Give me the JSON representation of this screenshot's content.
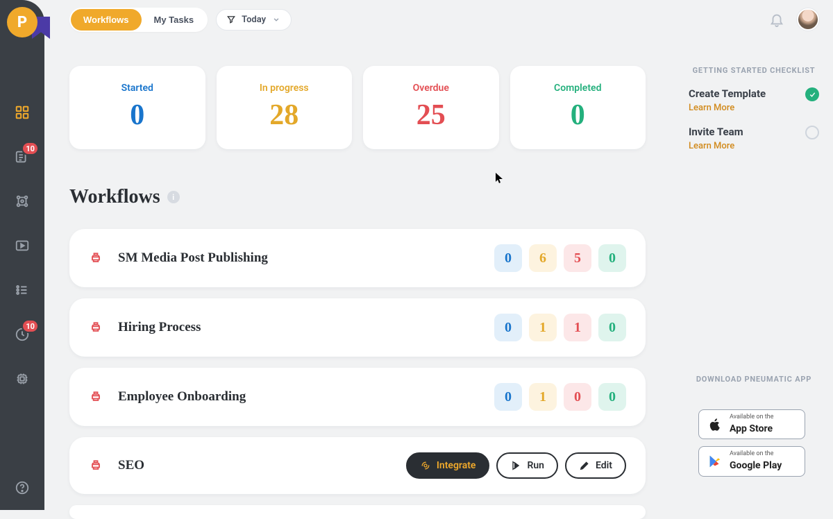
{
  "topbar": {
    "tabs": {
      "workflows": "Workflows",
      "mytasks": "My Tasks"
    },
    "dateFilter": "Today"
  },
  "stats": {
    "started": {
      "label": "Started",
      "value": "0"
    },
    "progress": {
      "label": "In progress",
      "value": "28"
    },
    "overdue": {
      "label": "Overdue",
      "value": "25"
    },
    "completed": {
      "label": "Completed",
      "value": "0"
    }
  },
  "section": {
    "title": "Workflows"
  },
  "sidebar": {
    "badge1": "10",
    "badge2": "10"
  },
  "workflows": [
    {
      "name": "SM Media Post Publishing",
      "s": "0",
      "p": "6",
      "o": "5",
      "c": "0"
    },
    {
      "name": "Hiring Process",
      "s": "0",
      "p": "1",
      "o": "1",
      "c": "0"
    },
    {
      "name": "Employee Onboarding",
      "s": "0",
      "p": "1",
      "o": "0",
      "c": "0"
    },
    {
      "name": "SEO"
    }
  ],
  "rowActions": {
    "integrate": "Integrate",
    "run": "Run",
    "edit": "Edit"
  },
  "checklist": {
    "title": "GETTING STARTED CHECKLIST",
    "learn": "Learn More",
    "items": [
      {
        "title": "Create Template",
        "done": true
      },
      {
        "title": "Invite Team",
        "done": false
      }
    ]
  },
  "download": {
    "title": "DOWNLOAD PNEUMATIC APP",
    "appstore_small": "Available on the",
    "appstore_big": "App Store",
    "play_small": "Available on the",
    "play_big": "Google Play"
  }
}
